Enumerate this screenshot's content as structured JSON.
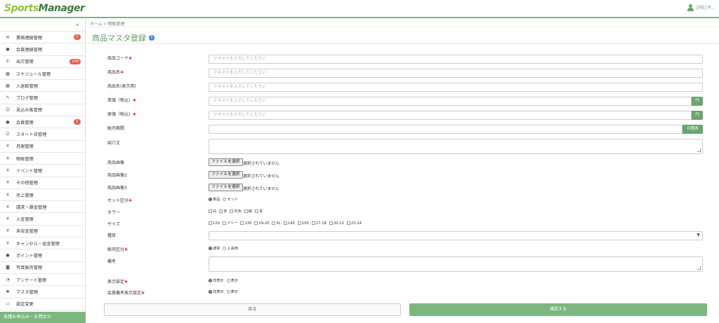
{
  "app": {
    "logo_part1": "Sports",
    "logo_part2": "Manager",
    "user_label": "[FE] P..."
  },
  "sidebar": {
    "collapse_icon": "«",
    "items": [
      {
        "label": "業務連絡管理",
        "icon": "envelope-icon",
        "glyph": "✉",
        "badge": "1"
      },
      {
        "label": "会員連絡管理",
        "icon": "chat-icon",
        "glyph": "●",
        "badge": ""
      },
      {
        "label": "出欠管理",
        "icon": "phone-icon",
        "glyph": "✆",
        "badge": "239"
      },
      {
        "label": "スケジュール管理",
        "icon": "calendar-icon",
        "glyph": "▦",
        "badge": ""
      },
      {
        "label": "入退館管理",
        "icon": "calendar-icon",
        "glyph": "▦",
        "badge": ""
      },
      {
        "label": "ブログ管理",
        "icon": "pencil-icon",
        "glyph": "✎",
        "badge": ""
      },
      {
        "label": "見込み客管理",
        "icon": "smile-icon",
        "glyph": "☺",
        "badge": ""
      },
      {
        "label": "会員管理",
        "icon": "user-icon",
        "glyph": "●",
        "badge": "2"
      },
      {
        "label": "スタート日管理",
        "icon": "check-icon",
        "glyph": "☑",
        "badge": ""
      },
      {
        "label": "月謝管理",
        "icon": "yen-icon",
        "glyph": "¥",
        "badge": ""
      },
      {
        "label": "物販管理",
        "icon": "yen-icon",
        "glyph": "¥",
        "badge": ""
      },
      {
        "label": "イベント管理",
        "icon": "yen-icon",
        "glyph": "¥",
        "badge": ""
      },
      {
        "label": "その他管理",
        "icon": "yen-icon",
        "glyph": "¥",
        "badge": ""
      },
      {
        "label": "売上管理",
        "icon": "yen-icon",
        "glyph": "¥",
        "badge": ""
      },
      {
        "label": "請求・課金管理",
        "icon": "yen-icon",
        "glyph": "¥",
        "badge": ""
      },
      {
        "label": "入金管理",
        "icon": "yen-icon",
        "glyph": "¥",
        "badge": ""
      },
      {
        "label": "未収金管理",
        "icon": "yen-icon",
        "glyph": "¥",
        "badge": ""
      },
      {
        "label": "キャンセル・返金管理",
        "icon": "yen-icon",
        "glyph": "¥",
        "badge": ""
      },
      {
        "label": "ポイント管理",
        "icon": "coin-icon",
        "glyph": "●",
        "badge": ""
      },
      {
        "label": "写真販売管理",
        "icon": "camera-icon",
        "glyph": "◙",
        "badge": ""
      },
      {
        "label": "アンケート管理",
        "icon": "dashboard-icon",
        "glyph": "◔",
        "badge": ""
      },
      {
        "label": "マスタ管理",
        "icon": "gear-icon",
        "glyph": "✱",
        "badge": ""
      },
      {
        "label": "設定変更",
        "icon": "monitor-icon",
        "glyph": "▭",
        "badge": ""
      }
    ],
    "footer": "各種お申込み・お問合せ"
  },
  "breadcrumb": {
    "home": "ホーム",
    "sep": "»",
    "current": "物販管理"
  },
  "page": {
    "title": "商品マスタ登録",
    "info_glyph": "i"
  },
  "form": {
    "placeholder": "テキストを入力してください",
    "fields": {
      "code": {
        "label": "商品コード",
        "req": "✱"
      },
      "name": {
        "label": "商品名",
        "req": "✱"
      },
      "display_name": {
        "label": "商品名(表示用)"
      },
      "price_tax": {
        "label": "単価（税込）",
        "req": "✱",
        "addon": "円"
      },
      "cost_tax": {
        "label": "原価（税込）",
        "req": "✱",
        "addon": "円"
      },
      "sale_period": {
        "label": "販売期間",
        "addon": "日程表"
      },
      "intro": {
        "label": "紹介文"
      },
      "image1": {
        "label": "商品画像"
      },
      "image2": {
        "label": "商品画像2"
      },
      "image3": {
        "label": "商品画像3"
      },
      "set_type": {
        "label": "セット区分",
        "req": "✱",
        "options": [
          "単品",
          "セット"
        ]
      },
      "color": {
        "label": "カラー",
        "options": [
          "白",
          "赤",
          "灰色",
          "紺",
          "青"
        ]
      },
      "size": {
        "label": "サイズ",
        "options": [
          "120",
          "フリー",
          "130",
          "19-20",
          "XL",
          "140",
          "150",
          "17-18",
          "20-22",
          "23-24"
        ]
      },
      "category": {
        "label": "種目"
      },
      "sale_type": {
        "label": "販売区分",
        "req": "✱",
        "options": [
          "通常",
          "入会用"
        ]
      },
      "notes": {
        "label": "備考"
      },
      "display_setting": {
        "label": "表示設定",
        "req": "✱",
        "options": [
          "非表示",
          "表示"
        ]
      },
      "member_display": {
        "label": "会員備考表示設定",
        "req": "✱",
        "options": [
          "非表示",
          "表示"
        ]
      }
    },
    "file_button": "ファイルを選択",
    "file_none": "選択されていません"
  },
  "actions": {
    "back": "戻る",
    "confirm": "確認する"
  }
}
